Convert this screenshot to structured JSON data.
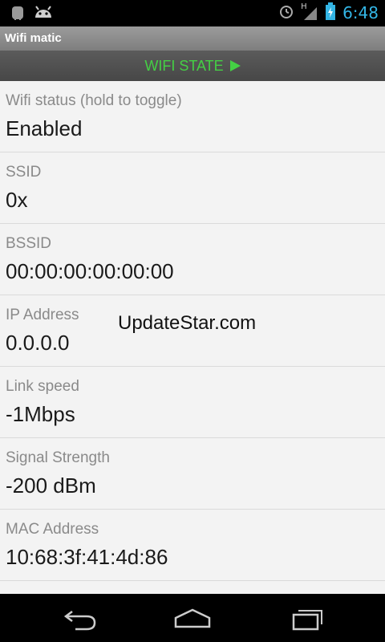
{
  "status_bar": {
    "time": "6:48",
    "icons_left": [
      "android-robot-icon",
      "android-head-icon"
    ],
    "icons_right": [
      "alarm-icon",
      "signal-h-icon",
      "battery-charging-icon"
    ],
    "network_type": "H"
  },
  "app": {
    "title": "Wifi matic"
  },
  "state_bar": {
    "label": "WIFI STATE",
    "accent": "#44d044"
  },
  "rows": [
    {
      "label": "Wifi status (hold to toggle)",
      "value": "Enabled"
    },
    {
      "label": "SSID",
      "value": "0x"
    },
    {
      "label": "BSSID",
      "value": "00:00:00:00:00:00"
    },
    {
      "label": "IP Address",
      "value": "0.0.0.0"
    },
    {
      "label": "Link speed",
      "value": "-1Mbps"
    },
    {
      "label": "Signal Strength",
      "value": "-200 dBm"
    },
    {
      "label": "MAC Address",
      "value": "10:68:3f:41:4d:86"
    }
  ],
  "watermark": "UpdateStar.com",
  "nav_bar": {
    "icons": [
      "back-icon",
      "home-icon",
      "recent-apps-icon"
    ]
  }
}
